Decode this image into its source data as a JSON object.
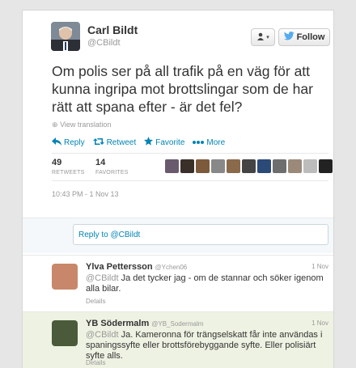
{
  "tweet": {
    "author_name": "Carl Bildt",
    "author_handle": "@CBildt",
    "text": "Om polis ser på all trafik på en väg för att kunna ingripa mot brottslingar som de har rätt att spana efter - är det fel?",
    "view_translation": "View translation",
    "follow_label": "Follow",
    "actions": {
      "reply": "Reply",
      "retweet": "Retweet",
      "favorite": "Favorite",
      "more": "More"
    },
    "retweets_count": "49",
    "retweets_label": "RETWEETS",
    "favorites_count": "14",
    "favorites_label": "FAVORITES",
    "timestamp": "10:43 PM - 1 Nov 13",
    "faver_colors": [
      "#6a5a6e",
      "#3b2f2a",
      "#7d5a3c",
      "#888",
      "#8a6a4a",
      "#444",
      "#2b4a78",
      "#6e6e6e",
      "#9b8a7a",
      "#bcbcbc",
      "#222"
    ]
  },
  "reply_box": {
    "placeholder": "Reply to @CBildt"
  },
  "replies": [
    {
      "name": "Ylva Pettersson",
      "handle": "@Ychen06",
      "date": "1 Nov",
      "mention": "@CBildt",
      "text": " Ja det tycker jag - om de stannar och söker igenom alla bilar.",
      "details": "Details",
      "bg": "#ffffff",
      "avatar_color": "#c8876a"
    },
    {
      "name": "YB Södermalm",
      "handle": "@YB_Sodermalm",
      "date": "1 Nov",
      "mention": "@CBildt",
      "text": " Ja. Kameronna för trängselskatt får inte användas i spaningssyfte eller brottsförebyggande syfte. Eller polisiärt syfte alls.",
      "details": "Details",
      "bg": "#eef2e2",
      "avatar_color": "#4a5a3a"
    }
  ]
}
